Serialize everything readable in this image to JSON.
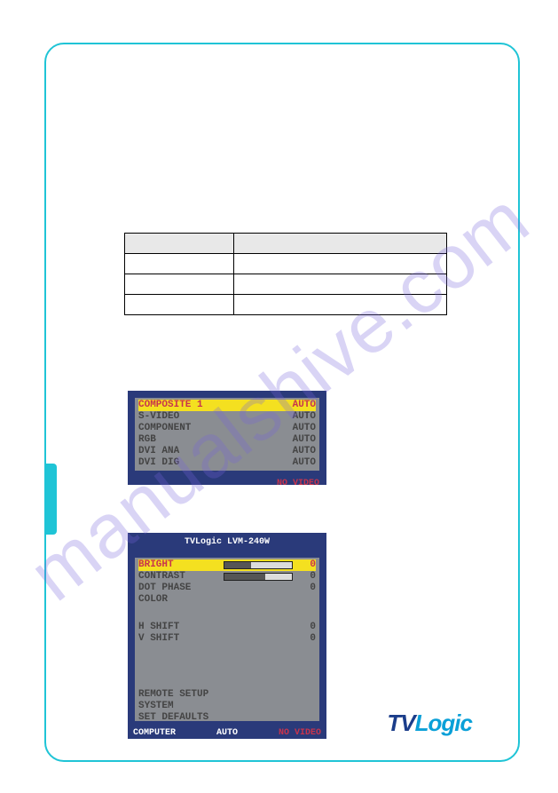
{
  "watermark": "manualshive.com",
  "osd1": {
    "rows": [
      {
        "label": "COMPOSITE  1",
        "value": "AUTO",
        "sel": true
      },
      {
        "label": "S-VIDEO",
        "value": "AUTO"
      },
      {
        "label": "COMPONENT",
        "value": "AUTO"
      },
      {
        "label": "RGB",
        "value": "AUTO"
      },
      {
        "label": "DVI ANA",
        "value": "AUTO"
      },
      {
        "label": "DVI DIG",
        "value": "AUTO"
      }
    ],
    "status": "NO VIDEO"
  },
  "osd2": {
    "title": "TVLogic   LVM-240W",
    "rows1": [
      {
        "label": "BRIGHT",
        "bar": 40,
        "value": "0",
        "sel": true
      },
      {
        "label": "CONTRAST",
        "bar": 60,
        "value": "0"
      },
      {
        "label": "DOT PHASE",
        "value": "0"
      },
      {
        "label": "COLOR",
        "value": ""
      }
    ],
    "rows2": [
      {
        "label": "H SHIFT",
        "value": "0"
      },
      {
        "label": "V SHIFT",
        "value": "0"
      }
    ],
    "rows3": [
      {
        "label": "REMOTE SETUP"
      },
      {
        "label": "SYSTEM"
      },
      {
        "label": "SET DEFAULTS"
      }
    ],
    "footer": {
      "left": "COMPUTER",
      "mid": "AUTO",
      "right": "NO VIDEO"
    }
  },
  "brand": {
    "a": "TV",
    "b": "Logic"
  }
}
